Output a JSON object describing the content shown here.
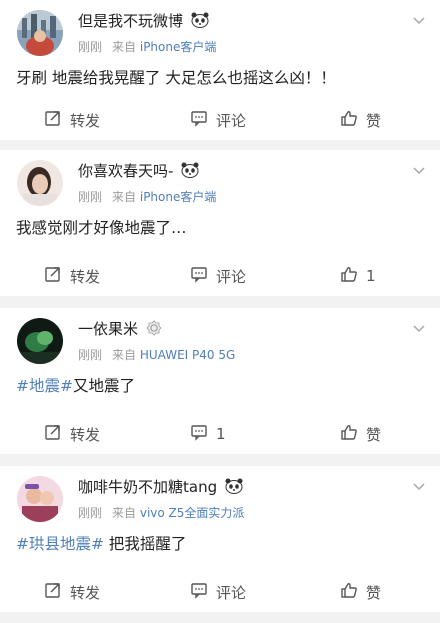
{
  "icons": {
    "panda": "panda-icon",
    "vip": "vip-badge-icon",
    "chevron": "chevron-down-icon",
    "repost": "repost-icon",
    "comment": "comment-icon",
    "like": "like-icon"
  },
  "colors": {
    "link": "#4f7fb7",
    "meta": "#9b9b9b",
    "text": "#222222",
    "bg": "#f2f2f2"
  },
  "posts": [
    {
      "username": "但是我不玩微博",
      "time": "刚刚",
      "source_prefix": "来自",
      "device": "iPhone客户端",
      "text": "牙刷 地震给我晃醒了 大足怎么也摇这么凶！！",
      "repost_label": "转发",
      "comment_label": "评论",
      "like_label": "赞"
    },
    {
      "username": "你喜欢春天吗-",
      "time": "刚刚",
      "source_prefix": "来自",
      "device": "iPhone客户端",
      "text": "我感觉刚才好像地震了…",
      "repost_label": "转发",
      "comment_label": "评论",
      "like_label": "1"
    },
    {
      "username": "一依果米",
      "time": "刚刚",
      "source_prefix": "来自",
      "device": "HUAWEI P40 5G",
      "tag": "#地震#",
      "text_after_tag": "又地震了",
      "repost_label": "转发",
      "comment_label": "1",
      "like_label": "赞"
    },
    {
      "username": "咖啡牛奶不加糖tang",
      "time": "刚刚",
      "source_prefix": "来自",
      "device": "vivo Z5全面实力派",
      "tag": "#珙县地震#",
      "text_after_tag": " 把我摇醒了",
      "repost_label": "转发",
      "comment_label": "评论",
      "like_label": "赞"
    }
  ]
}
